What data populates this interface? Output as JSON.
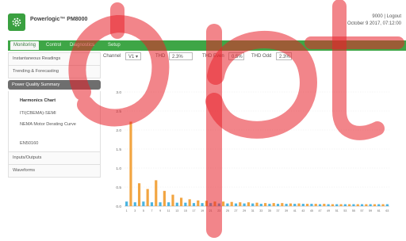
{
  "header": {
    "app_title": "Powerlogic™ PM8000",
    "user": "9000",
    "separator": "|",
    "logout": "Logout",
    "datetime": "October 9 2017, 07:12:00"
  },
  "nav": {
    "tabs": [
      {
        "label": "Monitoring",
        "active": true
      },
      {
        "label": "Control",
        "active": false
      },
      {
        "label": "Diagnostics",
        "active": false
      },
      {
        "label": "Setup",
        "active": false
      }
    ]
  },
  "sidebar": {
    "items": [
      {
        "label": "Instantaneous Readings"
      },
      {
        "label": "Trending & Forecasting"
      },
      {
        "label": "Power Quality Summary",
        "active": true
      },
      {
        "label": "Inputs/Outputs"
      },
      {
        "label": "Waveforms"
      }
    ],
    "subitems": [
      {
        "label": "Harmonics Chart",
        "bold": true
      },
      {
        "label": "ITI(CBEMA)-SEMI"
      },
      {
        "label": "NEMA Motor Derating Curve"
      },
      {
        "label": "EN50160"
      }
    ]
  },
  "controls": {
    "channel_label": "Channel",
    "channel_value": "V1 ▾",
    "thd_label": "THD",
    "thd_value": "2.3%",
    "thd_even_label": "THD Even",
    "thd_even_value": "0.5%",
    "thd_odd_label": "THD Odd",
    "thd_odd_value": "2.3%"
  },
  "colors": {
    "brand_green": "#3ea646",
    "bar_odd": "#4ab4e0",
    "bar_even": "#f2a541",
    "watermark": "#e8202a"
  },
  "watermark_text": "opt",
  "chart_data": {
    "type": "bar",
    "x": [
      1,
      2,
      3,
      4,
      5,
      6,
      7,
      8,
      9,
      10,
      11,
      12,
      13,
      14,
      15,
      16,
      17,
      18,
      19,
      20,
      21,
      22,
      23,
      24,
      25,
      26,
      27,
      28,
      29,
      30,
      31,
      32,
      33,
      34,
      35,
      36,
      37,
      38,
      39,
      40,
      41,
      42,
      43,
      44,
      45,
      46,
      47,
      48,
      49,
      50,
      51,
      52,
      53,
      54,
      55,
      56,
      57,
      58,
      59,
      60,
      61,
      62,
      63
    ],
    "x_tick_labels": [
      "1",
      "3",
      "5",
      "7",
      "9",
      "11",
      "13",
      "15",
      "17",
      "19",
      "21",
      "23",
      "25",
      "27",
      "29",
      "31",
      "33",
      "35",
      "37",
      "39",
      "41",
      "43",
      "45",
      "47",
      "49",
      "51",
      "53",
      "55",
      "57",
      "59",
      "61",
      "63"
    ],
    "ylim": [
      0,
      3.0
    ],
    "y_ticks": [
      0.0,
      0.5,
      1.0,
      1.5,
      2.0,
      2.5,
      3.0
    ],
    "y_tick_labels": [
      "0.0",
      "0.5",
      "1.0",
      "1.5",
      "2.0",
      "2.5",
      "3.0"
    ],
    "series": [
      {
        "values": [
          0.12,
          2.22,
          0.1,
          0.6,
          0.12,
          0.45,
          0.1,
          0.68,
          0.1,
          0.4,
          0.1,
          0.3,
          0.09,
          0.22,
          0.09,
          0.18,
          0.08,
          0.15,
          0.08,
          0.14,
          0.08,
          0.12,
          0.07,
          0.12,
          0.07,
          0.11,
          0.07,
          0.1,
          0.07,
          0.1,
          0.07,
          0.09,
          0.06,
          0.08,
          0.06,
          0.08,
          0.06,
          0.08,
          0.06,
          0.07,
          0.06,
          0.07,
          0.06,
          0.06,
          0.06,
          0.06,
          0.05,
          0.06,
          0.05,
          0.05,
          0.05,
          0.05,
          0.05,
          0.05,
          0.05,
          0.05,
          0.05,
          0.05,
          0.05,
          0.05,
          0.05,
          0.05,
          0.05
        ]
      }
    ]
  }
}
